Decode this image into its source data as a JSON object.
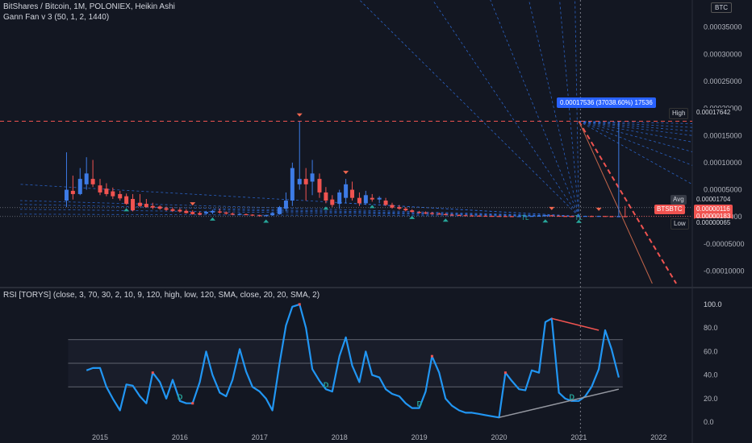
{
  "header": {
    "title": "BitShares / Bitcoin, 1M, POLONIEX, Heikin Ashi",
    "indicator": "Gann Fan v 3 (50, 1, 2, 1440)",
    "currency": "BTC"
  },
  "rsi_header": {
    "label": "RSI [TORYS] (close, 3, 70, 30, 2, 10, 9, 120, high, low, 120, SMA, close, 20, 20, SMA, 2)"
  },
  "tooltip": {
    "text": "0.00017536 (37038.60%) 17536"
  },
  "labels": {
    "high_tag": "High",
    "high_value": "0.00017642",
    "avg_tag": "Avg",
    "avg_value": "0.00001704",
    "sym_tag": "BTSBTC",
    "sym_value": "0.00000116",
    "sym_value2": "0.00000183",
    "low_tag": "Low",
    "low_value": "0.00000065",
    "tl": "TL",
    "d": "D"
  },
  "colors": {
    "background": "#131722",
    "up": "#2962ff",
    "up_light": "#3d7be6",
    "down": "#f05350",
    "rsi_line": "#2196f3",
    "fan": "#2f6fe0",
    "grid_text": "#b2b5be"
  },
  "chart_data": [
    {
      "type": "candlestick",
      "style": "heikin-ashi",
      "symbol": "BitShares / Bitcoin",
      "exchange": "POLONIEX",
      "interval": "1M",
      "y_ticks": [
        "0.00035000",
        "0.00030000",
        "0.00025000",
        "0.00020000",
        "0.00015000",
        "0.00010000",
        "0.00005000",
        "0.00000000",
        "-0.00005000",
        "-0.00010000"
      ],
      "ylim": [
        -0.000123,
        0.0004
      ],
      "x_ticks": [
        "2015",
        "2016",
        "2017",
        "2018",
        "2019",
        "2020",
        "2021",
        "2022"
      ],
      "high": 0.00017642,
      "average": 1.704e-05,
      "low": 6.5e-07,
      "last": 1.16e-06,
      "candles": [
        {
          "t": 2014.58,
          "o": 3e-05,
          "h": 0.000119,
          "l": 1.8e-05,
          "c": 5e-05
        },
        {
          "t": 2014.66,
          "o": 4.8e-05,
          "h": 7.6e-05,
          "l": 3.2e-05,
          "c": 4.2e-05
        },
        {
          "t": 2014.75,
          "o": 4.2e-05,
          "h": 9e-05,
          "l": 4e-05,
          "c": 7e-05
        },
        {
          "t": 2014.83,
          "o": 6e-05,
          "h": 0.00011,
          "l": 5e-05,
          "c": 8e-05
        },
        {
          "t": 2014.91,
          "o": 7e-05,
          "h": 0.000105,
          "l": 5.5e-05,
          "c": 6e-05
        },
        {
          "t": 2015.0,
          "o": 5.8e-05,
          "h": 7e-05,
          "l": 4e-05,
          "c": 4.5e-05
        },
        {
          "t": 2015.08,
          "o": 5.2e-05,
          "h": 6.2e-05,
          "l": 3.8e-05,
          "c": 4.2e-05
        },
        {
          "t": 2015.16,
          "o": 4.7e-05,
          "h": 5.4e-05,
          "l": 3.3e-05,
          "c": 3.8e-05
        },
        {
          "t": 2015.25,
          "o": 4.2e-05,
          "h": 4.8e-05,
          "l": 3e-05,
          "c": 3.4e-05
        },
        {
          "t": 2015.33,
          "o": 3.8e-05,
          "h": 4.3e-05,
          "l": 2.2e-05,
          "c": 2.4e-05
        },
        {
          "t": 2015.41,
          "o": 3.3e-05,
          "h": 4.2e-05,
          "l": 1e-05,
          "c": 1.2e-05
        },
        {
          "t": 2015.5,
          "o": 2.6e-05,
          "h": 4.2e-05,
          "l": 1.8e-05,
          "c": 2e-05
        },
        {
          "t": 2015.58,
          "o": 2.4e-05,
          "h": 3.3e-05,
          "l": 1.7e-05,
          "c": 1.8e-05
        },
        {
          "t": 2015.66,
          "o": 2e-05,
          "h": 2.6e-05,
          "l": 1.4e-05,
          "c": 1.7e-05
        },
        {
          "t": 2015.75,
          "o": 1.9e-05,
          "h": 2.1e-05,
          "l": 1.3e-05,
          "c": 1.5e-05
        },
        {
          "t": 2015.83,
          "o": 1.6e-05,
          "h": 1.9e-05,
          "l": 1.1e-05,
          "c": 1.3e-05
        },
        {
          "t": 2015.91,
          "o": 1.4e-05,
          "h": 1.7e-05,
          "l": 9e-06,
          "c": 1.1e-05
        },
        {
          "t": 2016.0,
          "o": 1.3e-05,
          "h": 1.6e-05,
          "l": 8e-06,
          "c": 1e-05
        },
        {
          "t": 2016.08,
          "o": 1.1e-05,
          "h": 1.4e-05,
          "l": 6e-06,
          "c": 7e-06
        },
        {
          "t": 2016.16,
          "o": 9e-06,
          "h": 1.2e-05,
          "l": 4e-06,
          "c": 5e-06
        },
        {
          "t": 2016.25,
          "o": 7e-06,
          "h": 1e-05,
          "l": 3e-06,
          "c": 4e-06
        },
        {
          "t": 2016.33,
          "o": 6e-06,
          "h": 1.1e-05,
          "l": 4e-06,
          "c": 9e-06
        },
        {
          "t": 2016.41,
          "o": 8e-06,
          "h": 1.3e-05,
          "l": 5e-06,
          "c": 1.1e-05
        },
        {
          "t": 2016.5,
          "o": 1e-05,
          "h": 1.5e-05,
          "l": 6e-06,
          "c": 8e-06
        },
        {
          "t": 2016.58,
          "o": 8e-06,
          "h": 1e-05,
          "l": 4e-06,
          "c": 6e-06
        },
        {
          "t": 2016.66,
          "o": 6e-06,
          "h": 8e-06,
          "l": 3e-06,
          "c": 4e-06
        },
        {
          "t": 2016.75,
          "o": 4.5e-06,
          "h": 7e-06,
          "l": 3e-06,
          "c": 5.5e-06
        },
        {
          "t": 2016.83,
          "o": 5e-06,
          "h": 6e-06,
          "l": 3e-06,
          "c": 4e-06
        },
        {
          "t": 2016.91,
          "o": 4e-06,
          "h": 5e-06,
          "l": 2e-06,
          "c": 3e-06
        },
        {
          "t": 2017.0,
          "o": 3e-06,
          "h": 4e-06,
          "l": 1e-06,
          "c": 2e-06
        },
        {
          "t": 2017.08,
          "o": 2e-06,
          "h": 4e-06,
          "l": 1e-06,
          "c": 3e-06
        },
        {
          "t": 2017.16,
          "o": 3e-06,
          "h": 8e-06,
          "l": 2e-06,
          "c": 7e-06
        },
        {
          "t": 2017.25,
          "o": 5e-06,
          "h": 2e-05,
          "l": 4e-06,
          "c": 1.8e-05
        },
        {
          "t": 2017.33,
          "o": 1.5e-05,
          "h": 4.5e-05,
          "l": 1e-05,
          "c": 3e-05
        },
        {
          "t": 2017.41,
          "o": 3e-05,
          "h": 0.0001,
          "l": 2e-05,
          "c": 9e-05
        },
        {
          "t": 2017.5,
          "o": 6e-05,
          "h": 0.000176,
          "l": 5e-05,
          "c": 7e-05
        },
        {
          "t": 2017.58,
          "o": 7e-05,
          "h": 9e-05,
          "l": 3e-05,
          "c": 6e-05
        },
        {
          "t": 2017.66,
          "o": 6.5e-05,
          "h": 0.000105,
          "l": 4e-05,
          "c": 8e-05
        },
        {
          "t": 2017.75,
          "o": 7e-05,
          "h": 8e-05,
          "l": 3.5e-05,
          "c": 4.5e-05
        },
        {
          "t": 2017.83,
          "o": 4.5e-05,
          "h": 5.5e-05,
          "l": 2.5e-05,
          "c": 3e-05
        },
        {
          "t": 2017.91,
          "o": 3.2e-05,
          "h": 4e-05,
          "l": 1.8e-05,
          "c": 2.2e-05
        },
        {
          "t": 2018.0,
          "o": 2.4e-05,
          "h": 5e-05,
          "l": 1.5e-05,
          "c": 4.5e-05
        },
        {
          "t": 2018.08,
          "o": 3.5e-05,
          "h": 7e-05,
          "l": 2.5e-05,
          "c": 6e-05
        },
        {
          "t": 2018.16,
          "o": 5e-05,
          "h": 6.5e-05,
          "l": 3e-05,
          "c": 3.5e-05
        },
        {
          "t": 2018.25,
          "o": 3.5e-05,
          "h": 4.5e-05,
          "l": 2e-05,
          "c": 2.5e-05
        },
        {
          "t": 2018.33,
          "o": 2.5e-05,
          "h": 4.8e-05,
          "l": 2.2e-05,
          "c": 4e-05
        },
        {
          "t": 2018.41,
          "o": 3.5e-05,
          "h": 4.2e-05,
          "l": 2.8e-05,
          "c": 3.2e-05
        },
        {
          "t": 2018.5,
          "o": 3.2e-05,
          "h": 3.8e-05,
          "l": 2.5e-05,
          "c": 3.5e-05
        },
        {
          "t": 2018.58,
          "o": 3e-05,
          "h": 3.5e-05,
          "l": 2e-05,
          "c": 2.2e-05
        },
        {
          "t": 2018.66,
          "o": 2.2e-05,
          "h": 2.6e-05,
          "l": 1.5e-05,
          "c": 1.7e-05
        },
        {
          "t": 2018.75,
          "o": 1.8e-05,
          "h": 2.2e-05,
          "l": 1.3e-05,
          "c": 1.5e-05
        },
        {
          "t": 2018.83,
          "o": 1.5e-05,
          "h": 1.8e-05,
          "l": 1e-05,
          "c": 1.2e-05
        },
        {
          "t": 2018.91,
          "o": 1.2e-05,
          "h": 1.4e-05,
          "l": 8e-06,
          "c": 9e-06
        },
        {
          "t": 2019.0,
          "o": 9e-06,
          "h": 1.1e-05,
          "l": 6e-06,
          "c": 8e-06
        },
        {
          "t": 2019.08,
          "o": 8e-06,
          "h": 1e-05,
          "l": 5e-06,
          "c": 7e-06
        },
        {
          "t": 2019.16,
          "o": 7e-06,
          "h": 9e-06,
          "l": 4e-06,
          "c": 5.5e-06
        },
        {
          "t": 2019.25,
          "o": 6e-06,
          "h": 8e-06,
          "l": 4e-06,
          "c": 5e-06
        },
        {
          "t": 2019.33,
          "o": 5e-06,
          "h": 7e-06,
          "l": 3e-06,
          "c": 4e-06
        },
        {
          "t": 2019.41,
          "o": 4e-06,
          "h": 5.5e-06,
          "l": 2.5e-06,
          "c": 3.5e-06
        },
        {
          "t": 2019.5,
          "o": 3.5e-06,
          "h": 4.5e-06,
          "l": 2e-06,
          "c": 3e-06
        },
        {
          "t": 2019.58,
          "o": 3e-06,
          "h": 4e-06,
          "l": 1.8e-06,
          "c": 2.5e-06
        },
        {
          "t": 2019.66,
          "o": 2.5e-06,
          "h": 3.5e-06,
          "l": 1.5e-06,
          "c": 2.2e-06
        },
        {
          "t": 2019.75,
          "o": 2.2e-06,
          "h": 3e-06,
          "l": 1.4e-06,
          "c": 2e-06
        },
        {
          "t": 2019.83,
          "o": 2e-06,
          "h": 2.8e-06,
          "l": 1.2e-06,
          "c": 1.8e-06
        },
        {
          "t": 2019.91,
          "o": 1.8e-06,
          "h": 2.4e-06,
          "l": 1e-06,
          "c": 1.6e-06
        },
        {
          "t": 2020.0,
          "o": 1.6e-06,
          "h": 2.2e-06,
          "l": 9e-07,
          "c": 1.5e-06
        },
        {
          "t": 2020.08,
          "o": 1.5e-06,
          "h": 2e-06,
          "l": 8e-07,
          "c": 1.3e-06
        },
        {
          "t": 2020.16,
          "o": 1.3e-06,
          "h": 1.8e-06,
          "l": 7e-07,
          "c": 1.2e-06
        },
        {
          "t": 2020.25,
          "o": 1.2e-06,
          "h": 1.6e-06,
          "l": 7e-07,
          "c": 1.4e-06
        },
        {
          "t": 2020.33,
          "o": 1.3e-06,
          "h": 2e-06,
          "l": 8e-07,
          "c": 1.6e-06
        },
        {
          "t": 2020.41,
          "o": 1.5e-06,
          "h": 2.2e-06,
          "l": 1e-06,
          "c": 1.8e-06
        },
        {
          "t": 2020.5,
          "o": 1.7e-06,
          "h": 3e-06,
          "l": 1.2e-06,
          "c": 2.2e-06
        },
        {
          "t": 2020.58,
          "o": 2e-06,
          "h": 4e-06,
          "l": 1.5e-06,
          "c": 3e-06
        },
        {
          "t": 2020.66,
          "o": 2.8e-06,
          "h": 3.5e-06,
          "l": 1.6e-06,
          "c": 2e-06
        },
        {
          "t": 2020.75,
          "o": 2e-06,
          "h": 2.5e-06,
          "l": 1.2e-06,
          "c": 1.6e-06
        },
        {
          "t": 2020.83,
          "o": 1.6e-06,
          "h": 2e-06,
          "l": 1e-06,
          "c": 1.4e-06
        },
        {
          "t": 2020.91,
          "o": 1.4e-06,
          "h": 1.8e-06,
          "l": 8e-07,
          "c": 1.2e-06
        },
        {
          "t": 2021.0,
          "o": 1.2e-06,
          "h": 1.6e-06,
          "l": 7e-07,
          "c": 1.4e-06
        },
        {
          "t": 2021.08,
          "o": 1.3e-06,
          "h": 2e-06,
          "l": 8e-07,
          "c": 1.8e-06
        },
        {
          "t": 2021.16,
          "o": 1.6e-06,
          "h": 2.2e-06,
          "l": 1e-06,
          "c": 1.5e-06
        },
        {
          "t": 2021.25,
          "o": 1.5e-06,
          "h": 2e-06,
          "l": 1e-06,
          "c": 1.7e-06
        },
        {
          "t": 2021.33,
          "o": 1.6e-06,
          "h": 1.8e-06,
          "l": 1e-06,
          "c": 1.2e-06
        },
        {
          "t": 2021.41,
          "o": 1.2e-06,
          "h": 1.5e-06,
          "l": 8e-07,
          "c": 1.1e-06
        },
        {
          "t": 2021.5,
          "o": 1.1e-06,
          "h": 0.0001754,
          "l": 6e-07,
          "c": 1.2e-06
        },
        {
          "t": 2021.58,
          "o": 1.2e-06,
          "h": 2e-05,
          "l": 8e-07,
          "c": 1.1e-06
        }
      ],
      "pivot_highs": [
        2017.5,
        2016.16,
        2018.08,
        2020.66,
        2021.25
      ],
      "pivot_lows": [
        2015.33,
        2016.41,
        2017.08,
        2017.83,
        2018.41,
        2018.91,
        2019.33,
        2020.58,
        2021.0
      ],
      "tl_labels": [
        2020.33,
        2021.0
      ]
    },
    {
      "type": "line",
      "name": "RSI",
      "y_ticks": [
        "100.0",
        "80.0",
        "60.0",
        "40.0",
        "20.0",
        "0.0"
      ],
      "ylim": [
        -4,
        104
      ],
      "bands": [
        30,
        50,
        70
      ],
      "x": [
        2014.83,
        2014.91,
        2015.0,
        2015.08,
        2015.16,
        2015.25,
        2015.33,
        2015.41,
        2015.5,
        2015.58,
        2015.66,
        2015.75,
        2015.83,
        2015.91,
        2016.0,
        2016.08,
        2016.16,
        2016.25,
        2016.33,
        2016.41,
        2016.5,
        2016.58,
        2016.66,
        2016.75,
        2016.83,
        2016.91,
        2017.0,
        2017.08,
        2017.16,
        2017.25,
        2017.33,
        2017.41,
        2017.5,
        2017.58,
        2017.66,
        2017.75,
        2017.83,
        2017.91,
        2018.0,
        2018.08,
        2018.16,
        2018.25,
        2018.33,
        2018.41,
        2018.5,
        2018.58,
        2018.66,
        2018.75,
        2018.83,
        2018.91,
        2019.0,
        2019.08,
        2019.16,
        2019.25,
        2019.33,
        2019.41,
        2019.5,
        2019.58,
        2019.66,
        2019.75,
        2019.83,
        2019.91,
        2020.0,
        2020.08,
        2020.16,
        2020.25,
        2020.33,
        2020.41,
        2020.5,
        2020.58,
        2020.66,
        2020.75,
        2020.83,
        2020.91,
        2021.0,
        2021.08,
        2021.16,
        2021.25,
        2021.33,
        2021.41,
        2021.5
      ],
      "values": [
        44,
        46,
        46,
        30,
        20,
        10,
        32,
        31,
        22,
        16,
        42,
        34,
        20,
        36,
        18,
        16,
        16,
        34,
        60,
        40,
        25,
        22,
        36,
        62,
        43,
        30,
        26,
        20,
        10,
        50,
        82,
        98,
        100,
        80,
        45,
        35,
        28,
        26,
        56,
        72,
        48,
        34,
        60,
        40,
        38,
        28,
        24,
        22,
        16,
        12,
        12,
        26,
        56,
        42,
        20,
        14,
        10,
        8,
        8,
        7,
        6,
        5,
        4,
        42,
        35,
        28,
        27,
        44,
        42,
        85,
        88,
        25,
        20,
        18,
        18,
        22,
        30,
        45,
        78,
        62,
        38,
        28
      ],
      "divergence_lines": [
        {
          "x": [
            2020.66,
            2021.25
          ],
          "y": [
            88,
            78
          ]
        },
        {
          "x": [
            2020.0,
            2021.5
          ],
          "y": [
            4,
            28
          ]
        }
      ],
      "markers_d": [
        2016.0,
        2017.83,
        2019.0,
        2020.91
      ],
      "markers_top": [
        2015.66,
        2016.16,
        2017.5,
        2019.16,
        2020.08
      ]
    }
  ]
}
